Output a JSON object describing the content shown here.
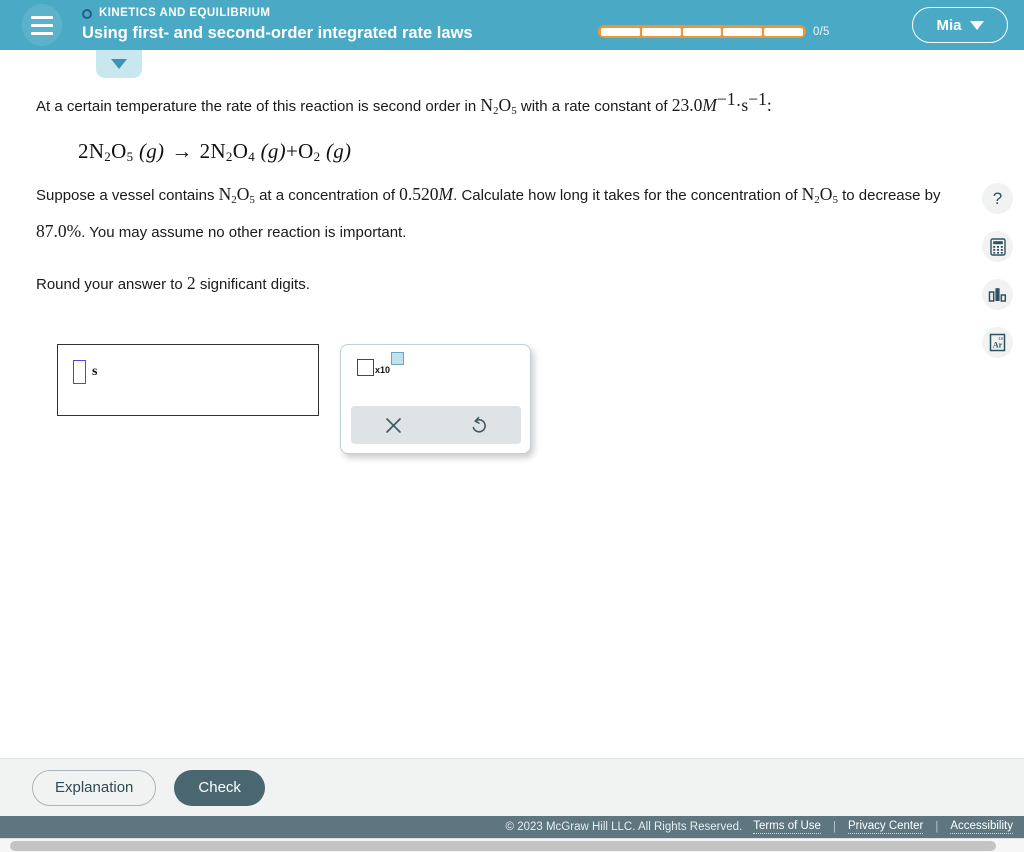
{
  "header": {
    "menu_icon": "hamburger-icon",
    "eyebrow": "KINETICS AND EQUILIBRIUM",
    "title": "Using first- and second-order integrated rate laws",
    "progress": {
      "total_segments": 5,
      "count_label": "0/5",
      "accent_color": "#ef9536"
    },
    "user": {
      "name": "Mia",
      "chevron_icon": "chevron-down-icon"
    },
    "background_color": "#4aaac6"
  },
  "collapse_tab": {
    "icon": "chevron-down-icon"
  },
  "problem": {
    "line1": {
      "a": "At a certain temperature the rate of this reaction is second order in ",
      "formula": "N₂O₅",
      "b": " with a rate constant of ",
      "rate_constant": "23.0",
      "unit_m": "M",
      "unit_m_exp": "−1",
      "unit_dot": "·s",
      "unit_s_exp": "−1",
      "c": ":"
    },
    "equation": {
      "lhs_coeff": "2",
      "lhs_species": "N2O5",
      "lhs_state": "(g)",
      "arrow": "→",
      "rhs1_coeff": "2",
      "rhs1_species": "N2O4",
      "rhs1_state": "(g)",
      "plus": "+",
      "rhs2_species": "O2",
      "rhs2_state": "(g)"
    },
    "line2": {
      "a": "Suppose a vessel contains ",
      "formula1": "N₂O₅",
      "b": " at a concentration of ",
      "concentration": "0.520",
      "conc_unit": "M",
      "c": ". Calculate how long it takes for the concentration of ",
      "formula2": "N₂O₅",
      "d": " to decrease by ",
      "percent": "87.0%",
      "e": ". You may assume no other reaction is important."
    },
    "line3": {
      "a": "Round your answer to ",
      "sig_digits": "2",
      "b": " significant digits."
    }
  },
  "answer": {
    "value": "",
    "unit": "s",
    "slot_border_color": "#4a46e0"
  },
  "popup": {
    "sci_notation": {
      "x10_label": "x10",
      "base_icon": "empty-square-icon",
      "exponent_icon": "exponent-square-icon"
    },
    "clear_icon": "close-x-icon",
    "undo_icon": "undo-arrow-icon"
  },
  "tools": [
    {
      "name": "help-icon",
      "glyph": "?"
    },
    {
      "name": "calculator-icon",
      "glyph": ""
    },
    {
      "name": "bar-chart-icon",
      "glyph": ""
    },
    {
      "name": "periodic-table-icon",
      "glyph": "Ar",
      "superscript": "18"
    }
  ],
  "actions": {
    "explanation_label": "Explanation",
    "check_label": "Check"
  },
  "footer": {
    "copyright": "© 2023 McGraw Hill LLC. All Rights Reserved.",
    "links": [
      "Terms of Use",
      "Privacy Center",
      "Accessibility"
    ],
    "separator": "|"
  }
}
